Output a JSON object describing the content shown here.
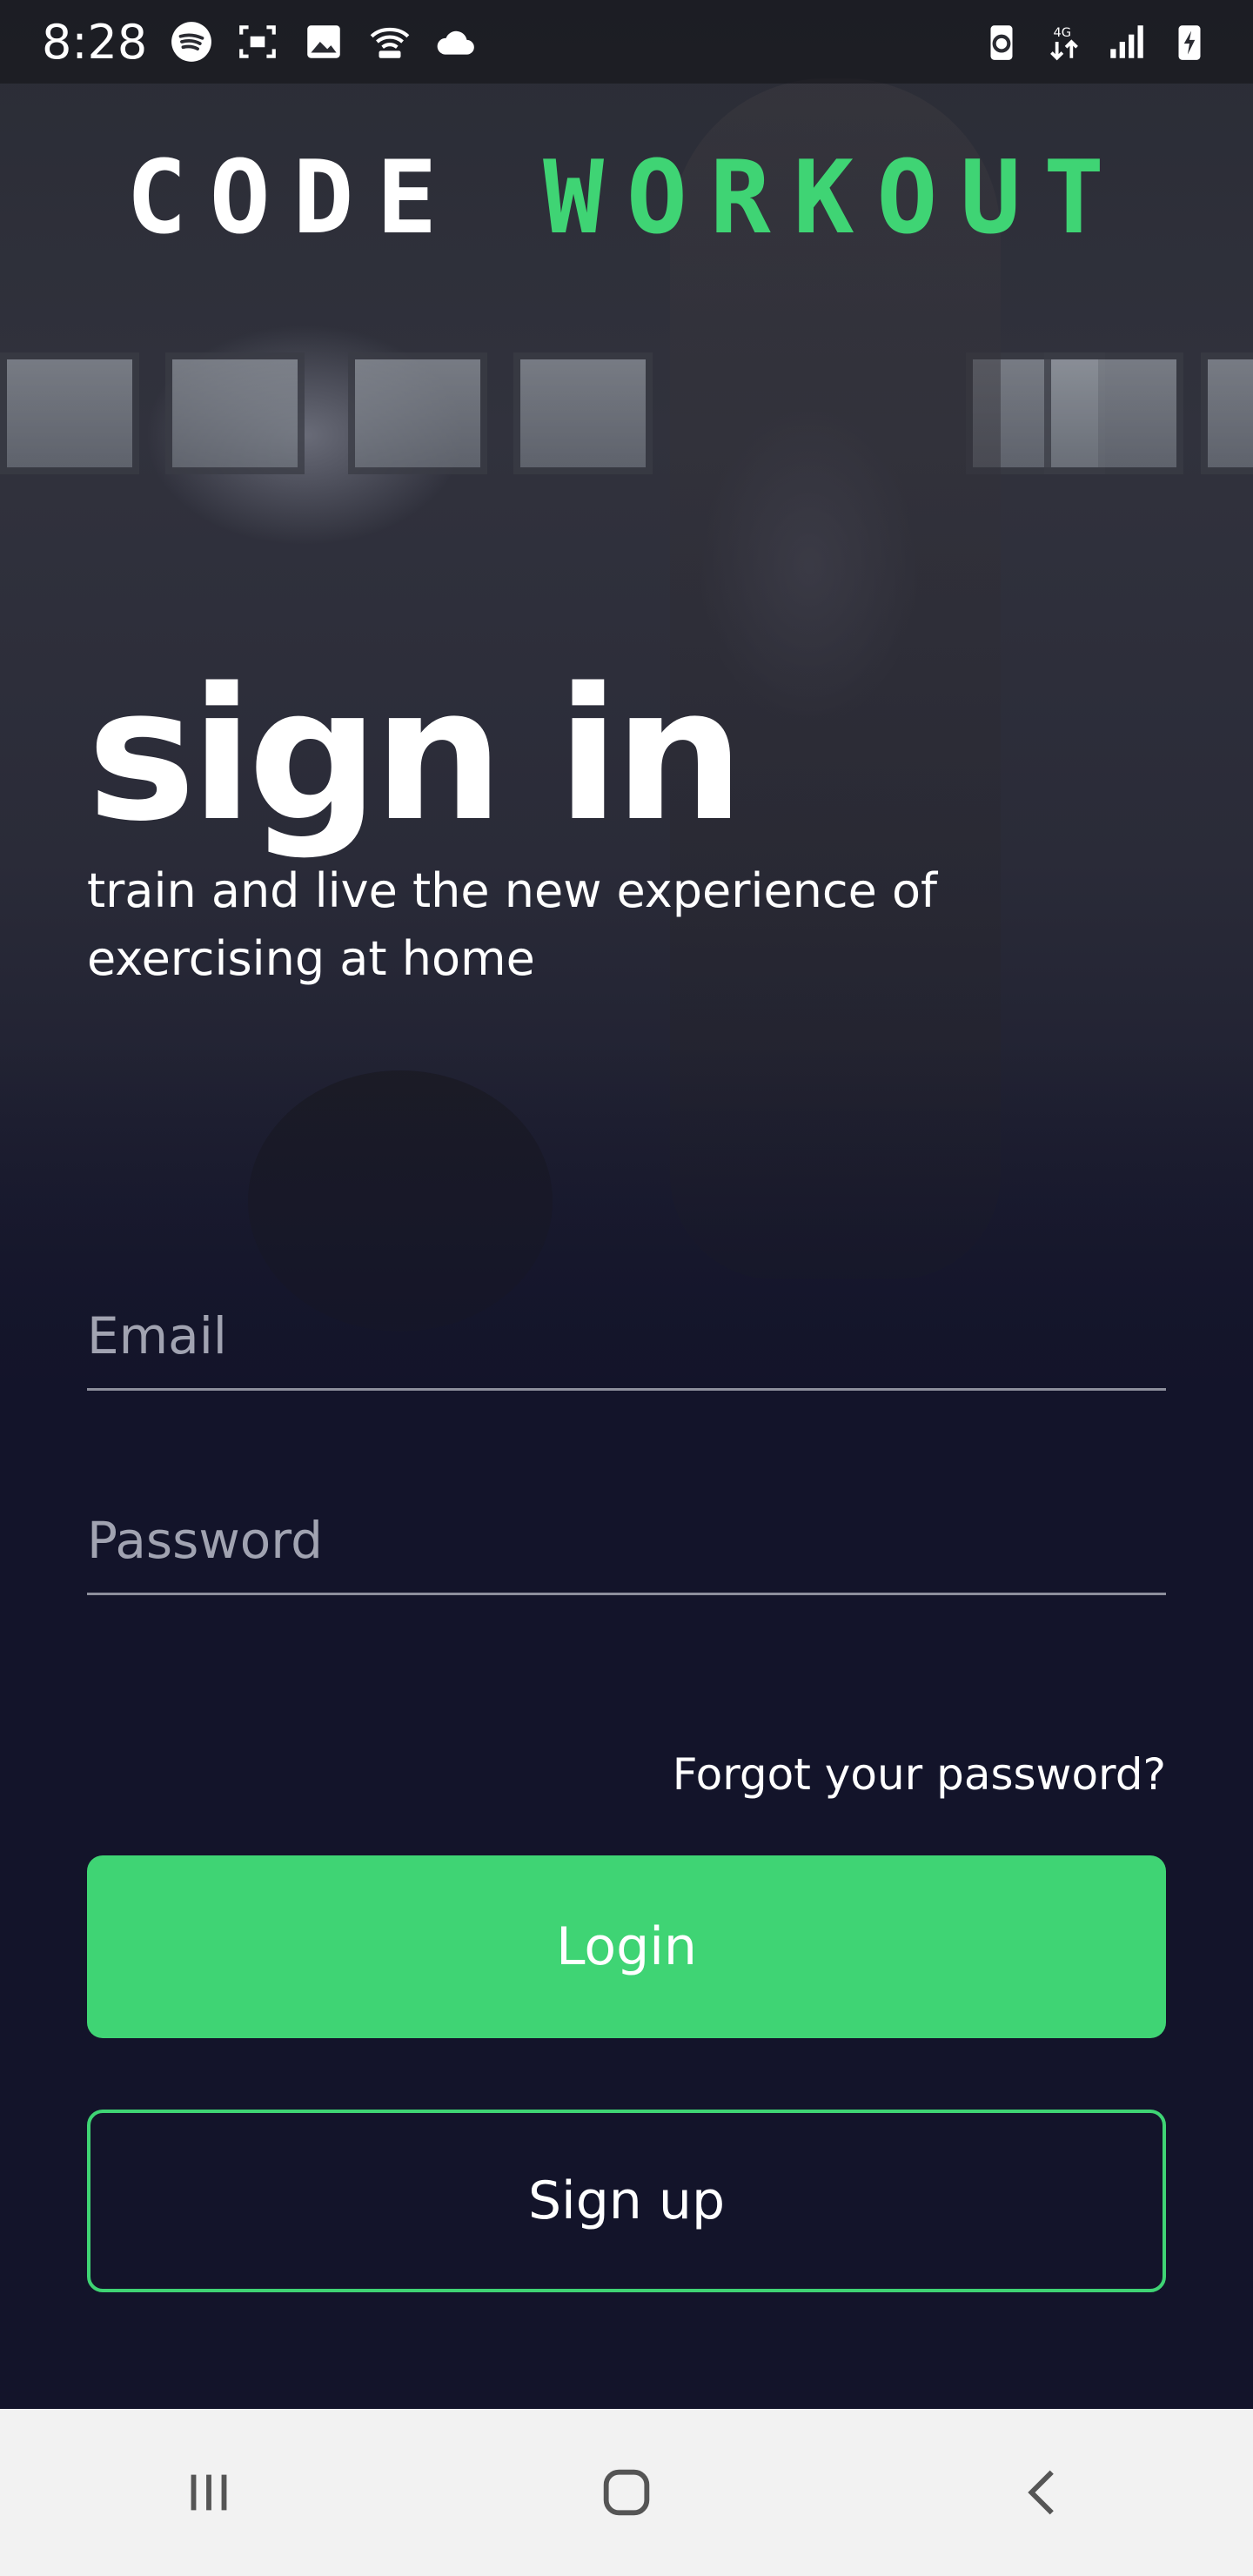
{
  "status_bar": {
    "time": "8:28",
    "left_icons": [
      "spotify-icon",
      "screen-record-icon",
      "gallery-icon",
      "wifi-calling-icon",
      "cloud-icon"
    ],
    "right_icons": [
      "battery-saver-icon",
      "4g-lte-icon",
      "signal-icon",
      "battery-charging-icon"
    ],
    "network": "4G LTE"
  },
  "brand": {
    "part1": "CODE",
    "part2": "WORKOUT",
    "accent_color": "#3fd474"
  },
  "hero": {
    "title": "sign in",
    "subtitle": "train and live the new experience of\n exercising at home"
  },
  "form": {
    "email_placeholder": "Email",
    "password_placeholder": "Password",
    "forgot_label": "Forgot your password?",
    "login_label": "Login",
    "signup_label": "Sign up"
  },
  "nav": {
    "items": [
      "recent-apps-icon",
      "home-icon",
      "back-icon"
    ]
  },
  "colors": {
    "background": "#13142a",
    "accent": "#3fd474",
    "nav_bg": "#f2f2f2"
  }
}
